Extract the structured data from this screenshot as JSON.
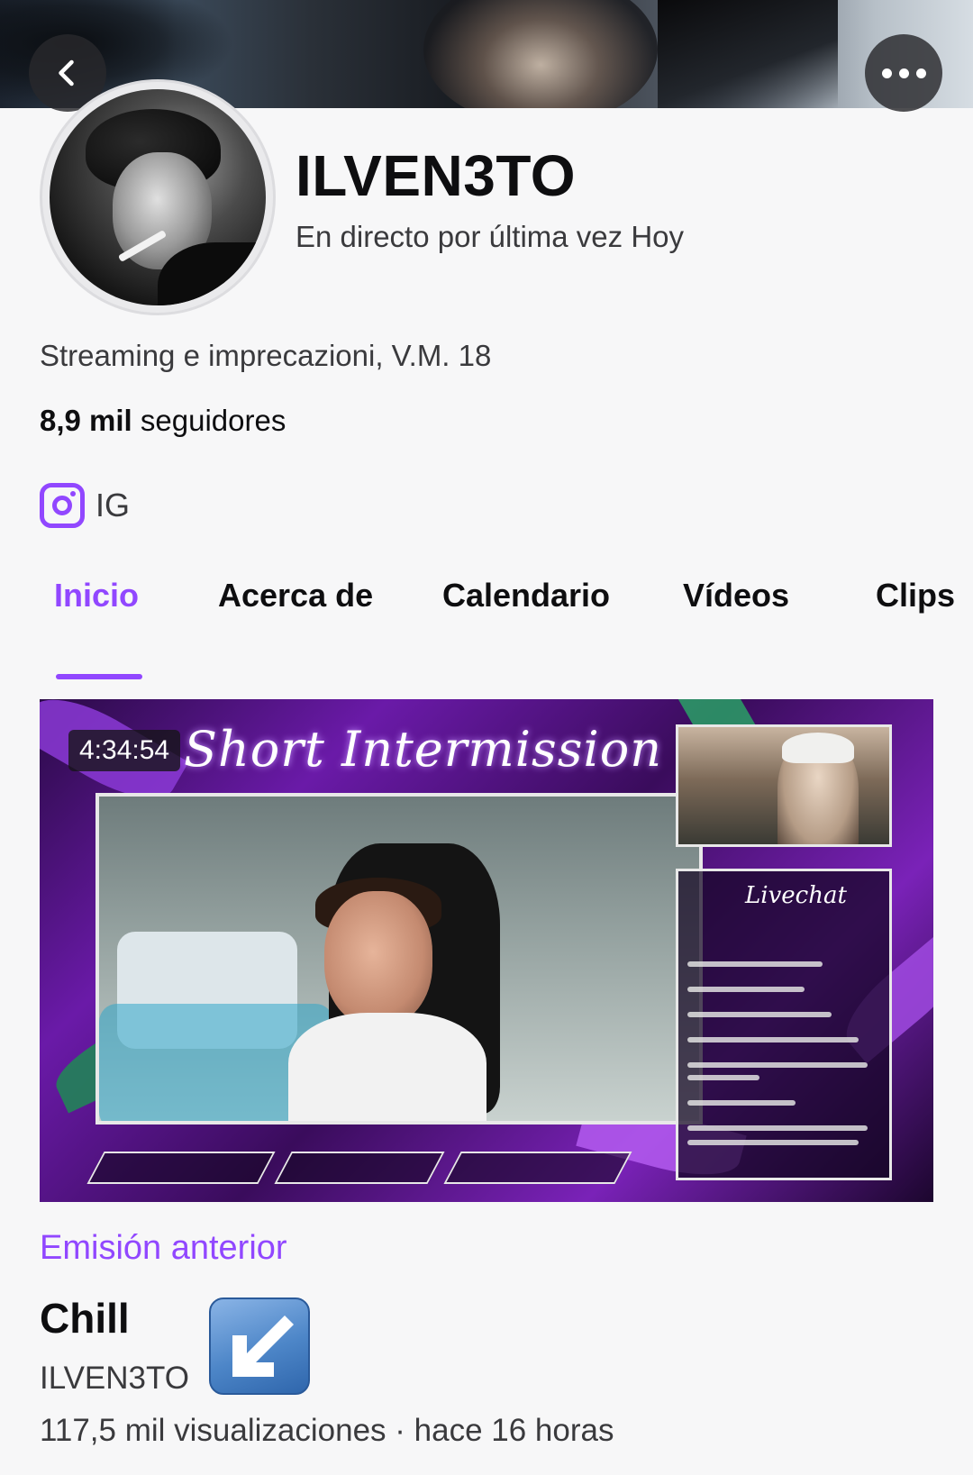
{
  "header": {
    "back_icon": "chevron-left-icon",
    "more_icon": "more-horizontal-icon"
  },
  "profile": {
    "channel_name": "ILVEN3TO",
    "last_live": "En directo por última vez Hoy",
    "bio": "Streaming e imprecazioni, V.M. 18",
    "followers_count": "8,9 mil",
    "followers_label": "seguidores",
    "social": {
      "icon": "instagram-icon",
      "label": "IG",
      "color": "#9147ff"
    }
  },
  "tabs": [
    {
      "label": "Inicio",
      "active": true
    },
    {
      "label": "Acerca de",
      "active": false
    },
    {
      "label": "Calendario",
      "active": false
    },
    {
      "label": "Vídeos",
      "active": false
    },
    {
      "label": "Clips",
      "active": false
    }
  ],
  "video": {
    "duration": "4:34:54",
    "overlay_title": "Short Intermission",
    "livechat_title": "Livechat"
  },
  "previous_stream": {
    "label": "Emisión anterior",
    "title": "Chill",
    "channel": "ILVEN3TO",
    "meta": "117,5 mil visualizaciones · hace 16 horas",
    "emoji": "arrow-down-left-emoji-icon"
  },
  "colors": {
    "accent": "#9147ff",
    "text_primary": "#0e0e10",
    "text_secondary": "#3a3a3d",
    "background": "#f7f7f8"
  }
}
